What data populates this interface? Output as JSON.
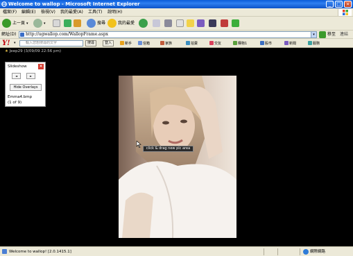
{
  "window": {
    "title": "Welcome to wallop - Microsoft Internet Explorer"
  },
  "menu": {
    "items": [
      "檔案(F)",
      "編輯(E)",
      "檢視(V)",
      "我的最愛(A)",
      "工具(T)",
      "說明(H)"
    ]
  },
  "toolbar": {
    "back_label": "上一頁",
    "search_label": "搜尋",
    "favorites_label": "我的最愛"
  },
  "address": {
    "label": "網址(D)",
    "url": "http://ugwallop.com/WallopFrame.aspx",
    "go_label": "移至",
    "links_label": "連結"
  },
  "yahoo": {
    "search_placeholder": "輸入您想搜尋的文字",
    "search_button": "搜尋",
    "signin_button": "登入",
    "links": [
      {
        "label": "新手",
        "color": "#e8a21c"
      },
      {
        "label": "信箱",
        "color": "#6a8fd8"
      },
      {
        "label": "家族",
        "color": "#c05b3b"
      },
      {
        "label": "拍賣",
        "color": "#3b8ec0"
      },
      {
        "label": "交友",
        "color": "#d8405b"
      },
      {
        "label": "購物1",
        "color": "#5aa03b"
      },
      {
        "label": "股市",
        "color": "#3b6ec0"
      },
      {
        "label": "新聞",
        "color": "#7a5bc0"
      },
      {
        "label": "服務",
        "color": "#3ba0a0"
      }
    ]
  },
  "content": {
    "photo_caption": "Jeep29 (3/09/09 22:56 pm)",
    "slideshow": {
      "title": "Slideshow",
      "close": "×",
      "prev": "◄",
      "next": "►",
      "overlay_button": "Hide Overlays",
      "file_name": "Emma4.bmp",
      "count": "(1 of 9)"
    },
    "tooltip": "click & drag new pic area"
  },
  "status": {
    "text": "Welcome to wallop! [2.0.1415.1]",
    "zone": "網際網路"
  }
}
